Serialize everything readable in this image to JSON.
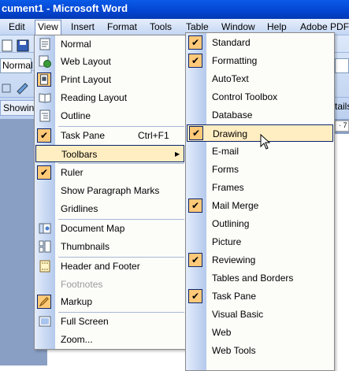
{
  "window": {
    "title": "cument1 - Microsoft Word"
  },
  "menubar": [
    "Edit",
    "View",
    "Insert",
    "Format",
    "Tools",
    "Table",
    "Window",
    "Help",
    "Adobe PDF"
  ],
  "toolbar": {
    "style_value": "Normal",
    "showing_label": "Showin",
    "right_label": "tails",
    "ruler_tick": "· 7"
  },
  "view_menu": {
    "items": [
      {
        "label": "Normal",
        "icon": "normal-view-icon"
      },
      {
        "label": "Web Layout",
        "icon": "web-layout-icon"
      },
      {
        "label": "Print Layout",
        "icon": "print-layout-icon",
        "checked": true
      },
      {
        "label": "Reading Layout",
        "icon": "reading-layout-icon"
      },
      {
        "label": "Outline",
        "icon": "outline-view-icon"
      },
      {
        "label": "Task Pane",
        "shortcut": "Ctrl+F1",
        "checked": true
      },
      {
        "label": "Toolbars",
        "submenu": true
      },
      {
        "label": "Ruler",
        "checked": true
      },
      {
        "label": "Show Paragraph Marks"
      },
      {
        "label": "Gridlines"
      },
      {
        "label": "Document Map",
        "icon": "document-map-icon"
      },
      {
        "label": "Thumbnails",
        "icon": "thumbnails-icon"
      },
      {
        "label": "Header and Footer",
        "icon": "header-footer-icon"
      },
      {
        "label": "Footnotes",
        "disabled": true
      },
      {
        "label": "Markup",
        "icon": "markup-icon",
        "checked": true
      },
      {
        "label": "Full Screen",
        "icon": "full-screen-icon"
      },
      {
        "label": "Zoom..."
      }
    ],
    "submenu_arrow": "▶"
  },
  "toolbars_menu": {
    "items": [
      {
        "label": "Standard",
        "checked": true
      },
      {
        "label": "Formatting",
        "checked": true
      },
      {
        "label": "AutoText"
      },
      {
        "label": "Control Toolbox"
      },
      {
        "label": "Database"
      },
      {
        "label": "Drawing",
        "checked": true,
        "highlighted": true
      },
      {
        "label": "E-mail"
      },
      {
        "label": "Forms"
      },
      {
        "label": "Frames"
      },
      {
        "label": "Mail Merge",
        "checked": true
      },
      {
        "label": "Outlining"
      },
      {
        "label": "Picture"
      },
      {
        "label": "Reviewing",
        "checked": true
      },
      {
        "label": "Tables and Borders"
      },
      {
        "label": "Task Pane",
        "checked": true
      },
      {
        "label": "Visual Basic"
      },
      {
        "label": "Web"
      },
      {
        "label": "Web Tools"
      }
    ]
  },
  "colors": {
    "titlebar": "#0345d0",
    "check_bg": "#ffc978",
    "highlight_bg": "#ffeec2",
    "gutter": "#b4c9ec"
  }
}
